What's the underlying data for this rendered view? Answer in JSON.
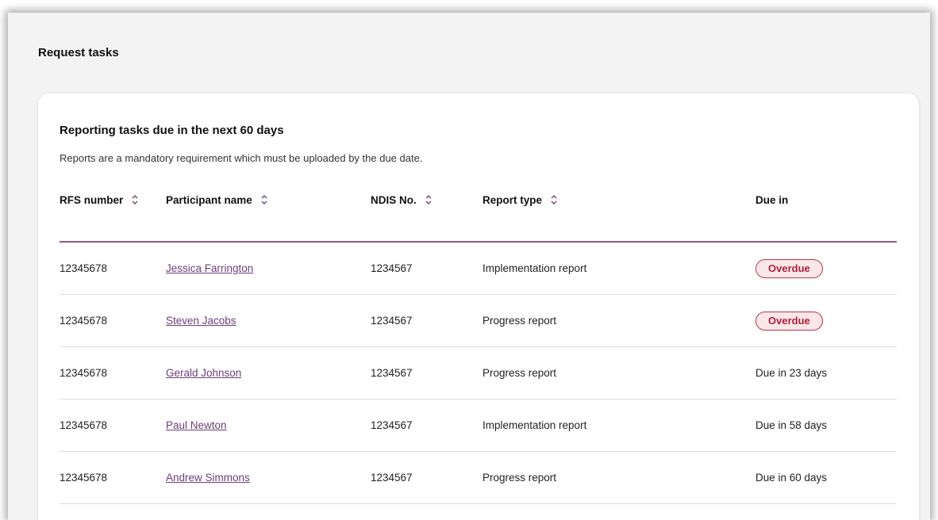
{
  "page": {
    "title": "Request tasks"
  },
  "card": {
    "title": "Reporting tasks due in the next 60 days",
    "description": "Reports are a mandatory requirement which must be uploaded by the due date."
  },
  "table": {
    "headers": [
      {
        "label": "RFS number",
        "sortable": true
      },
      {
        "label": "Participant name",
        "sortable": true
      },
      {
        "label": "NDIS No.",
        "sortable": true
      },
      {
        "label": "Report type",
        "sortable": true
      },
      {
        "label": "Due in",
        "sortable": false
      }
    ],
    "rows": [
      {
        "rfs": "12345678",
        "name": "Jessica Farrington",
        "ndis": "1234567",
        "type": "Implementation report",
        "due": "Overdue",
        "overdue": true
      },
      {
        "rfs": "12345678",
        "name": "Steven Jacobs",
        "ndis": "1234567",
        "type": "Progress report",
        "due": "Overdue",
        "overdue": true
      },
      {
        "rfs": "12345678",
        "name": "Gerald Johnson",
        "ndis": "1234567",
        "type": "Progress report",
        "due": "Due in 23 days",
        "overdue": false
      },
      {
        "rfs": "12345678",
        "name": "Paul Newton",
        "ndis": "1234567",
        "type": "Implementation report",
        "due": "Due in 58 days",
        "overdue": false
      },
      {
        "rfs": "12345678",
        "name": "Andrew Simmons",
        "ndis": "1234567",
        "type": "Progress report",
        "due": "Due in 60 days",
        "overdue": false
      }
    ]
  },
  "colors": {
    "accent": "#8b5a87",
    "link": "#6b3f7c",
    "overdue_text": "#b01f38",
    "overdue_bg": "#fbe7ea"
  },
  "icons": {
    "sort": "sort-arrows-icon"
  }
}
